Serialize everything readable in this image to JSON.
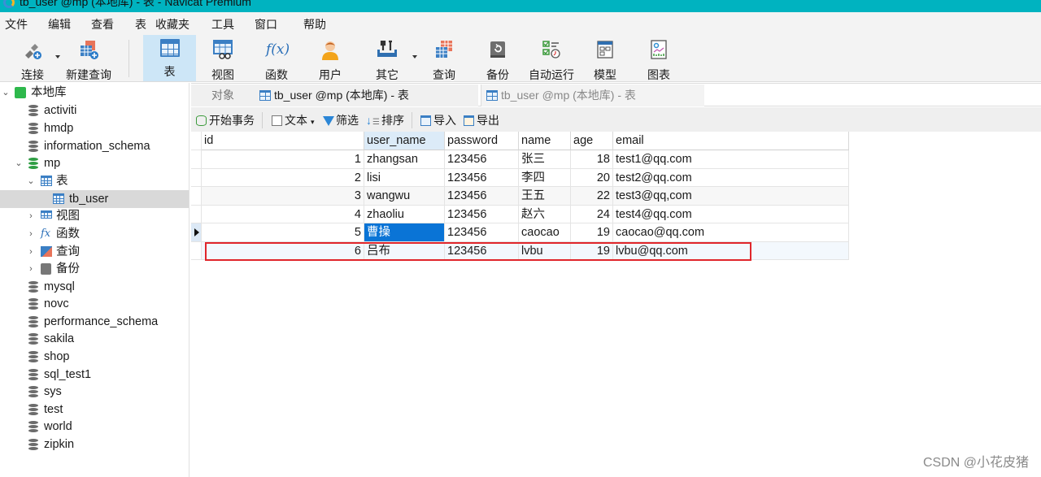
{
  "window": {
    "title": "tb_user @mp (本地库) - 表 - Navicat Premium"
  },
  "menu": [
    "文件",
    "编辑",
    "查看",
    "表",
    "收藏夹",
    "工具",
    "窗口",
    "帮助"
  ],
  "toolbar": {
    "connect": "连接",
    "new_query": "新建查询",
    "table": "表",
    "view": "视图",
    "function": "函数",
    "user": "用户",
    "other": "其它",
    "query": "查询",
    "backup": "备份",
    "automation": "自动运行",
    "model": "模型",
    "chart": "图表",
    "function_glyph": "f(x)"
  },
  "sidebar": {
    "connection": "本地库",
    "databases_before": [
      "activiti",
      "hmdp",
      "information_schema"
    ],
    "open_db": "mp",
    "tables_folder": "表",
    "selected_table": "tb_user",
    "mp_children": [
      "视图",
      "函数",
      "查询",
      "备份"
    ],
    "databases_after": [
      "mysql",
      "novc",
      "performance_schema",
      "sakila",
      "shop",
      "sql_test1",
      "sys",
      "test",
      "world",
      "zipkin"
    ]
  },
  "tabs": {
    "objects": "对象",
    "active": "tb_user @mp (本地库) - 表",
    "inactive": "tb_user @mp (本地库) - 表"
  },
  "subtoolbar": {
    "begin_transaction": "开始事务",
    "text": "文本",
    "filter": "筛选",
    "sort": "排序",
    "import": "导入",
    "export": "导出"
  },
  "table": {
    "columns": [
      "id",
      "user_name",
      "password",
      "name",
      "age",
      "email"
    ],
    "rows": [
      {
        "id": "1",
        "user_name": "zhangsan",
        "password": "123456",
        "name": "张三",
        "age": "18",
        "email": "test1@qq.com"
      },
      {
        "id": "2",
        "user_name": "lisi",
        "password": "123456",
        "name": "李四",
        "age": "20",
        "email": "test2@qq.com"
      },
      {
        "id": "3",
        "user_name": "wangwu",
        "password": "123456",
        "name": "王五",
        "age": "22",
        "email": "test3@qq,com"
      },
      {
        "id": "4",
        "user_name": "zhaoliu",
        "password": "123456",
        "name": "赵六",
        "age": "24",
        "email": "test4@qq.com"
      },
      {
        "id": "5",
        "user_name": "曹操",
        "password": "123456",
        "name": "caocao",
        "age": "19",
        "email": "caocao@qq.com"
      },
      {
        "id": "6",
        "user_name": "吕布",
        "password": "123456",
        "name": "lvbu",
        "age": "19",
        "email": "lvbu@qq.com"
      }
    ]
  },
  "watermark": "CSDN @小花皮猪"
}
